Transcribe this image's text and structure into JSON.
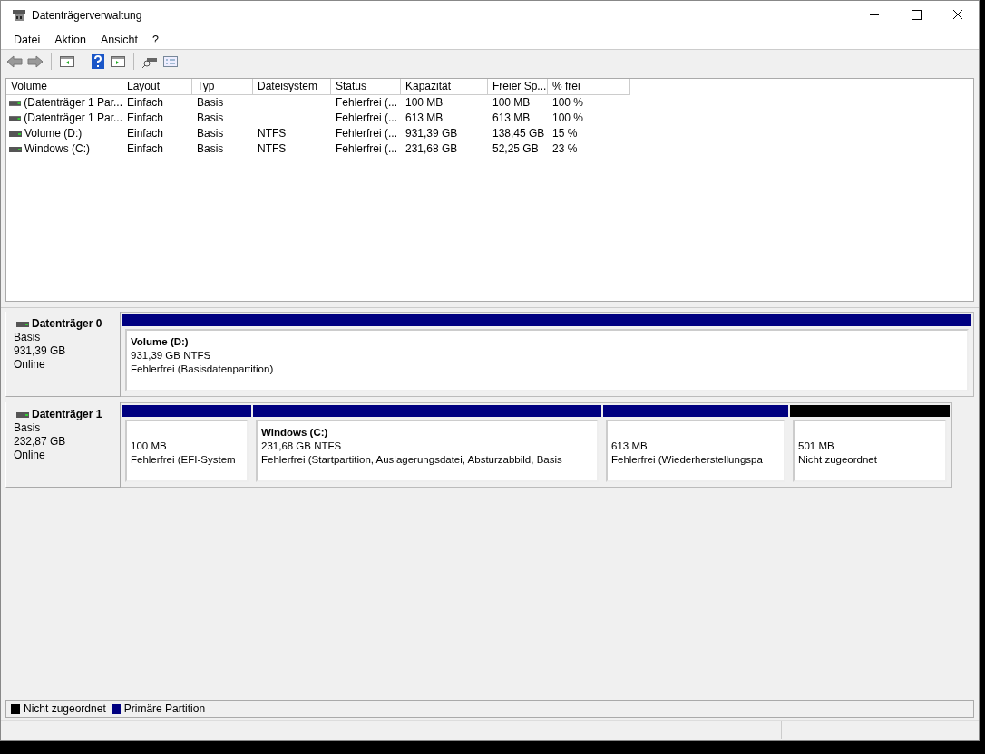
{
  "window": {
    "title": "Datenträgerverwaltung"
  },
  "menu": [
    "Datei",
    "Aktion",
    "Ansicht",
    "?"
  ],
  "volume_table": {
    "columns": [
      "Volume",
      "Layout",
      "Typ",
      "Dateisystem",
      "Status",
      "Kapazität",
      "Freier Sp...",
      "% frei"
    ],
    "rows": [
      {
        "cells": [
          "(Datenträger 1 Par...",
          "Einfach",
          "Basis",
          "",
          "Fehlerfrei (...",
          "100 MB",
          "100 MB",
          "100 %"
        ]
      },
      {
        "cells": [
          "(Datenträger 1 Par...",
          "Einfach",
          "Basis",
          "",
          "Fehlerfrei (...",
          "613 MB",
          "613 MB",
          "100 %"
        ]
      },
      {
        "cells": [
          "Volume (D:)",
          "Einfach",
          "Basis",
          "NTFS",
          "Fehlerfrei (...",
          "931,39 GB",
          "138,45 GB",
          "15 %"
        ]
      },
      {
        "cells": [
          "Windows (C:)",
          "Einfach",
          "Basis",
          "NTFS",
          "Fehlerfrei (...",
          "231,68 GB",
          "52,25 GB",
          "23 %"
        ]
      }
    ]
  },
  "disks": [
    {
      "name": "Datenträger 0",
      "type": "Basis",
      "size": "931,39 GB",
      "state": "Online",
      "partitions": [
        {
          "title": "Volume  (D:)",
          "size": "931,39 GB NTFS",
          "status": "Fehlerfrei (Basisdatenpartition)",
          "color": "#000080"
        }
      ]
    },
    {
      "name": "Datenträger 1",
      "type": "Basis",
      "size": "232,87 GB",
      "state": "Online",
      "partitions": [
        {
          "size": "100 MB",
          "status": "Fehlerfrei (EFI-System",
          "color": "#000080"
        },
        {
          "title": "Windows  (C:)",
          "size": "231,68 GB NTFS",
          "status": "Fehlerfrei (Startpartition, Auslagerungsdatei, Absturzabbild, Basis",
          "color": "#000080"
        },
        {
          "size": "613 MB",
          "status": "Fehlerfrei (Wiederherstellungspa",
          "color": "#000080"
        },
        {
          "size": "501 MB",
          "status": "Nicht zugeordnet",
          "color": "#000000"
        }
      ]
    }
  ],
  "legend": [
    {
      "label": "Nicht zugeordnet",
      "color": "#000000"
    },
    {
      "label": "Primäre Partition",
      "color": "#000080"
    }
  ]
}
